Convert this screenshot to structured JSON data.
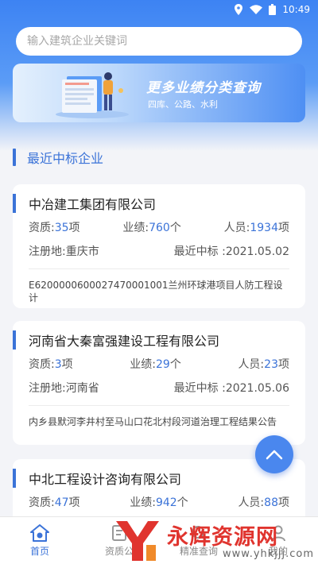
{
  "status_bar": {
    "time": "10:49"
  },
  "search": {
    "placeholder": "输入建筑企业关键词"
  },
  "banner": {
    "title": "更多业绩分类查询",
    "subtitle": "四库、公路、水利"
  },
  "section": {
    "title": "最近中标企业"
  },
  "companies": [
    {
      "name": "中冶建工集团有限公司",
      "qual_label": "资质:",
      "qual_value": "35",
      "qual_unit": "项",
      "perf_label": "业绩:",
      "perf_value": "760",
      "perf_unit": "个",
      "staff_label": "人员:",
      "staff_value": "1934",
      "staff_unit": "项",
      "region": "注册地:重庆市",
      "latest_win": "最近中标 :2021.05.02",
      "project": "E6200000600027470001001兰州环球港项目人防工程设计"
    },
    {
      "name": "河南省大秦富强建设工程有限公司",
      "qual_label": "资质:",
      "qual_value": "3",
      "qual_unit": "项",
      "perf_label": "业绩:",
      "perf_value": "29",
      "perf_unit": "个",
      "staff_label": "人员:",
      "staff_value": "23",
      "staff_unit": "项",
      "region": "注册地:河南省",
      "latest_win": "最近中标 :2021.05.06",
      "project": "内乡县默河李井村至马山口花北村段河道治理工程结果公告"
    },
    {
      "name": "中北工程设计咨询有限公司",
      "qual_label": "资质:",
      "qual_value": "47",
      "qual_unit": "项",
      "perf_label": "业绩:",
      "perf_value": "942",
      "perf_unit": "个",
      "staff_label": "人员:",
      "staff_value": "88",
      "staff_unit": "项"
    }
  ],
  "tabs": [
    {
      "label": "首页",
      "icon": "home-icon",
      "active": true
    },
    {
      "label": "资质公",
      "icon": "qualification-icon",
      "active": false
    },
    {
      "label": "精准查询",
      "icon": "query-icon",
      "active": false
    },
    {
      "label": "我的",
      "icon": "profile-icon",
      "active": false
    }
  ],
  "watermark": {
    "text": "永辉资源网",
    "url": "www.yhkjjj.com"
  },
  "colors": {
    "accent": "#3b73d8",
    "header": "#3d83f3",
    "watermark": "#e0342e"
  }
}
